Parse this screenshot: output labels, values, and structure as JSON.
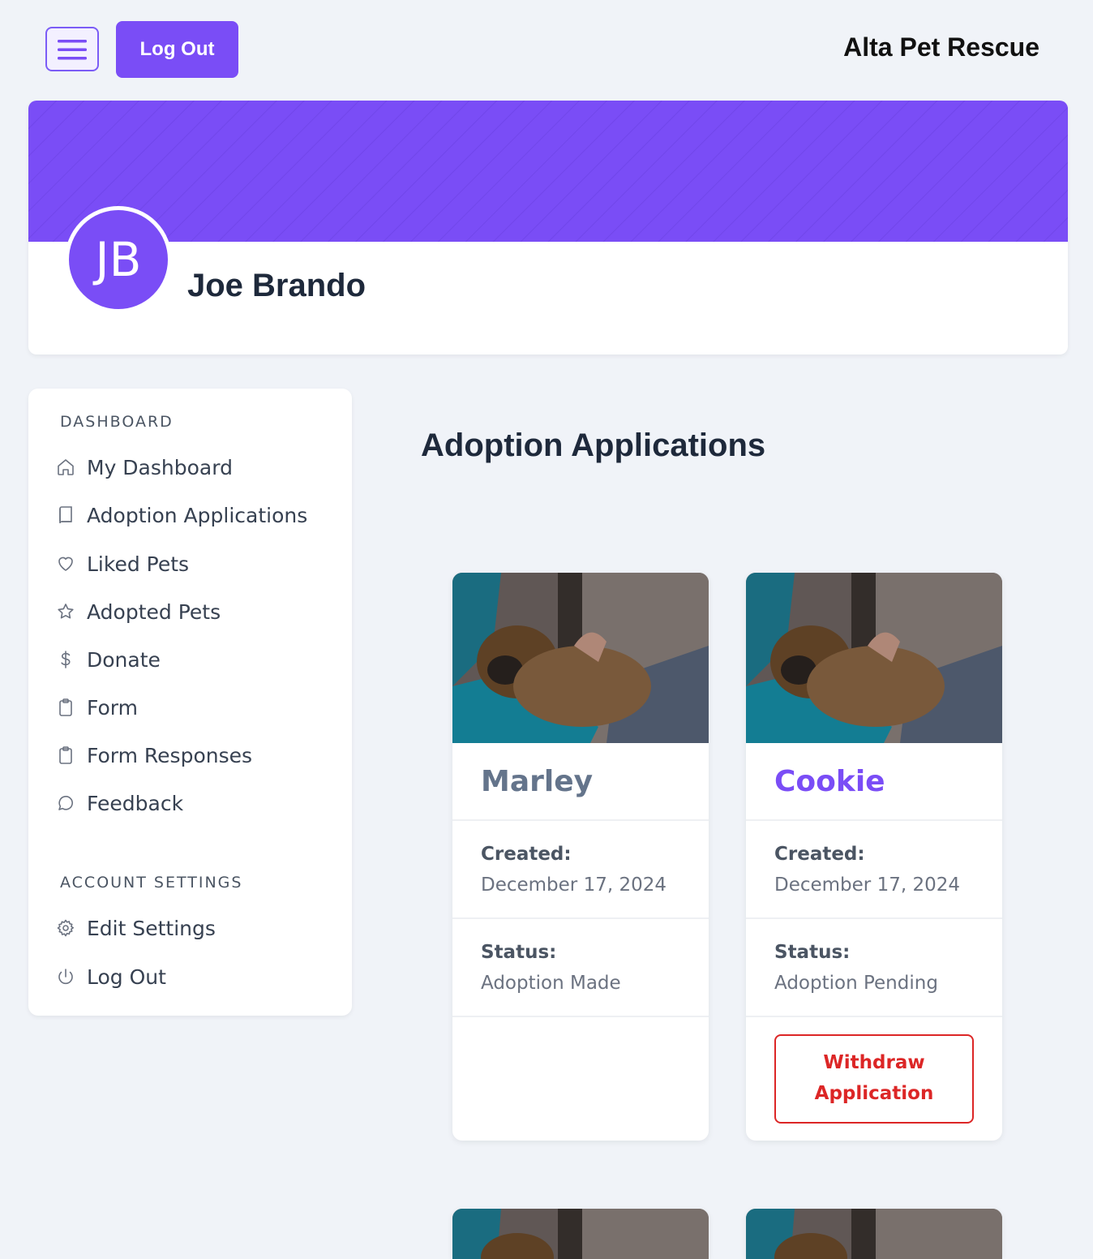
{
  "header": {
    "logout_label": "Log Out",
    "brand": "Alta Pet Rescue"
  },
  "profile": {
    "initials": "JB",
    "name": "Joe Brando"
  },
  "sidebar": {
    "sections": [
      {
        "heading": "DASHBOARD",
        "items": [
          {
            "label": "My Dashboard",
            "icon": "home-icon"
          },
          {
            "label": "Adoption Applications",
            "icon": "book-icon"
          },
          {
            "label": "Liked Pets",
            "icon": "heart-icon"
          },
          {
            "label": "Adopted Pets",
            "icon": "star-icon"
          },
          {
            "label": "Donate",
            "icon": "dollar-icon"
          },
          {
            "label": "Form",
            "icon": "clipboard-icon"
          },
          {
            "label": "Form Responses",
            "icon": "clipboard-icon"
          },
          {
            "label": "Feedback",
            "icon": "chat-bubble-icon"
          }
        ]
      },
      {
        "heading": "ACCOUNT SETTINGS",
        "items": [
          {
            "label": "Edit Settings",
            "icon": "gear-icon"
          },
          {
            "label": "Log Out",
            "icon": "power-icon"
          }
        ]
      }
    ]
  },
  "main": {
    "title": "Adoption Applications",
    "applications": [
      {
        "pet_name": "Marley",
        "created_label": "Created:",
        "created_value": "December 17, 2024",
        "status_label": "Status:",
        "status_value": "Adoption Made"
      },
      {
        "pet_name": "Cookie",
        "created_label": "Created:",
        "created_value": "December 17, 2024",
        "status_label": "Status:",
        "status_value": "Adoption Pending",
        "action_label": "Withdraw Application"
      }
    ]
  },
  "colors": {
    "accent": "#7a4df6",
    "danger": "#dc2626",
    "page_bg": "#f0f3f8"
  }
}
